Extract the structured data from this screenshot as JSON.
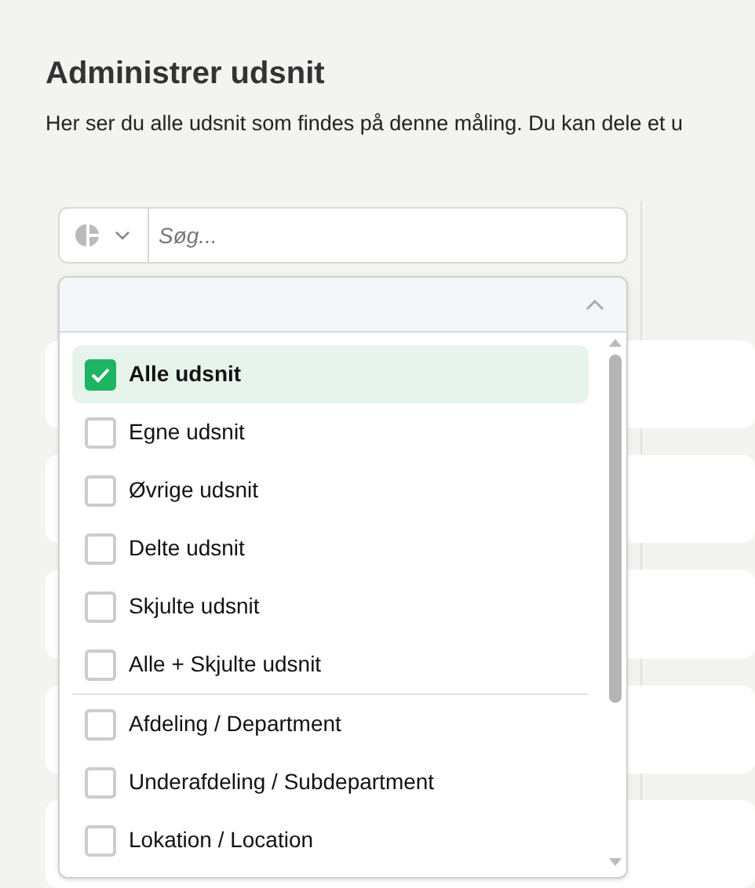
{
  "title": "Administrer udsnit",
  "description": "Her ser du alle udsnit som findes på denne måling. Du kan dele et u",
  "search": {
    "placeholder": "Søg..."
  },
  "dropdown": {
    "expanded": true,
    "groups": [
      {
        "options": [
          {
            "label": "Alle udsnit",
            "checked": true
          },
          {
            "label": "Egne udsnit",
            "checked": false
          },
          {
            "label": "Øvrige udsnit",
            "checked": false
          },
          {
            "label": "Delte udsnit",
            "checked": false
          },
          {
            "label": "Skjulte udsnit",
            "checked": false
          },
          {
            "label": "Alle + Skjulte udsnit",
            "checked": false
          }
        ]
      },
      {
        "options": [
          {
            "label": "Afdeling / Department",
            "checked": false
          },
          {
            "label": "Underafdeling / Subdepartment",
            "checked": false
          },
          {
            "label": "Lokation / Location",
            "checked": false
          }
        ]
      }
    ]
  }
}
